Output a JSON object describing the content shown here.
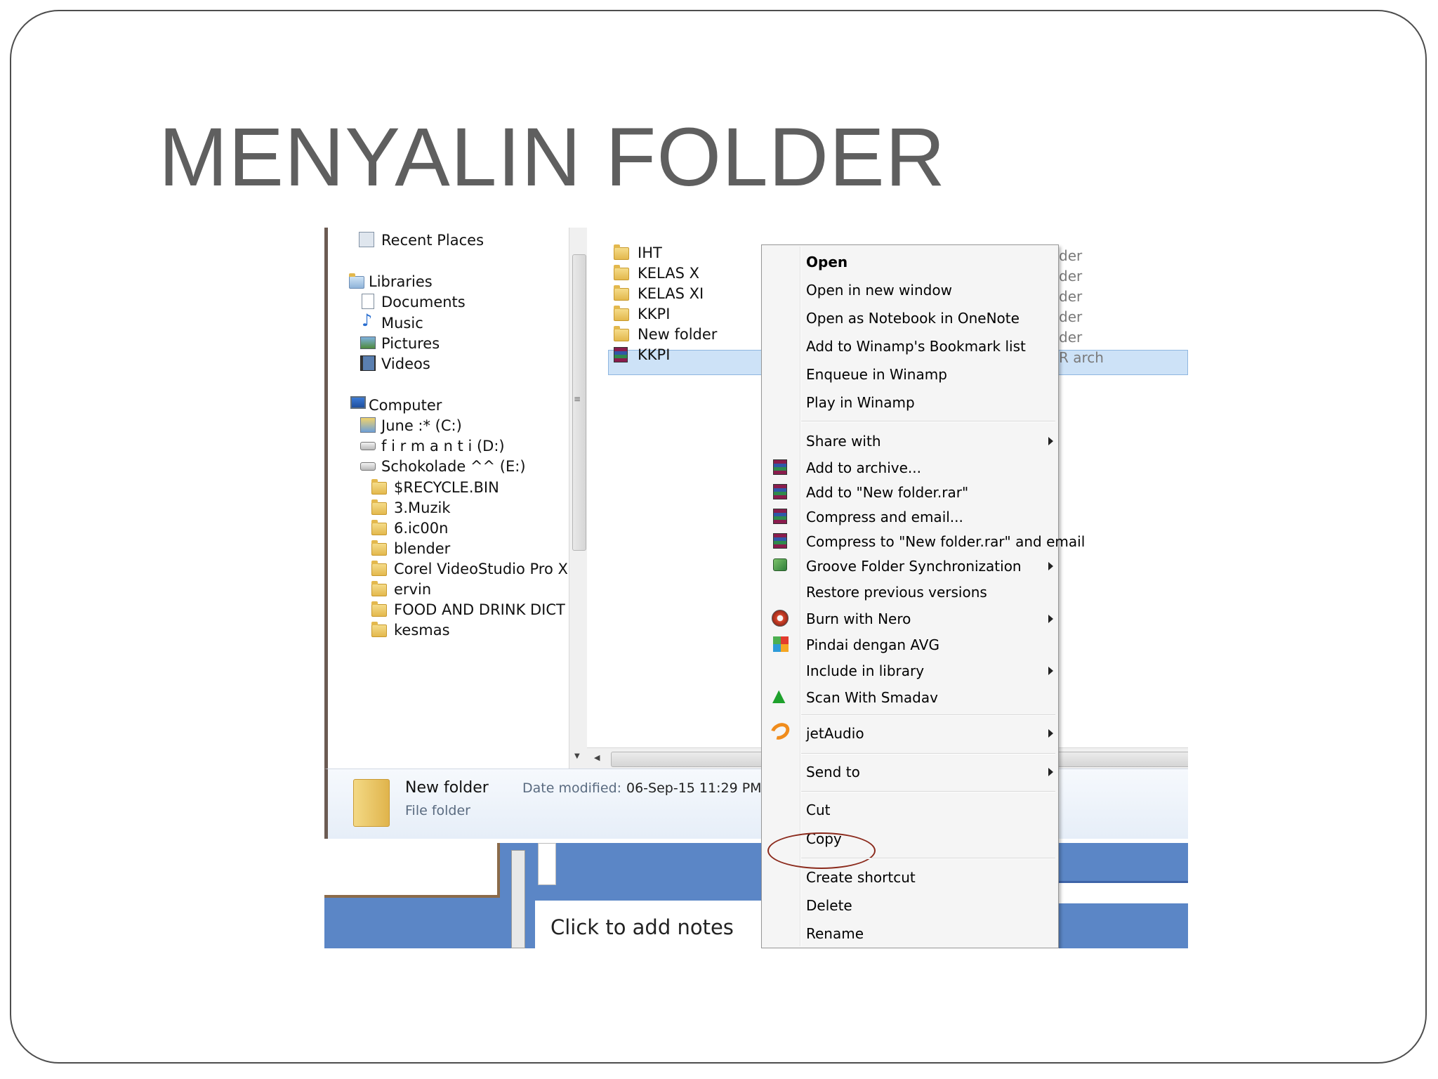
{
  "slide": {
    "title": "MENYALIN FOLDER"
  },
  "nav": {
    "items": [
      {
        "label": "Recent Places",
        "icon": "recent-places-icon"
      },
      {
        "label": "Libraries",
        "icon": "libraries-icon"
      },
      {
        "label": "Documents",
        "icon": "documents-icon"
      },
      {
        "label": "Music",
        "icon": "music-icon"
      },
      {
        "label": "Pictures",
        "icon": "pictures-icon"
      },
      {
        "label": "Videos",
        "icon": "videos-icon"
      },
      {
        "label": "Computer",
        "icon": "computer-icon"
      },
      {
        "label": "June :* (C:)",
        "icon": "drive-icon"
      },
      {
        "label": "f i r m a n t i (D:)",
        "icon": "drive-icon"
      },
      {
        "label": "Schokolade ^^ (E:)",
        "icon": "drive-icon"
      },
      {
        "label": "$RECYCLE.BIN",
        "icon": "folder-icon"
      },
      {
        "label": "3.Muzik",
        "icon": "folder-icon"
      },
      {
        "label": "6.ic00n",
        "icon": "folder-icon"
      },
      {
        "label": "blender",
        "icon": "folder-icon"
      },
      {
        "label": "Corel VideoStudio Pro X",
        "icon": "folder-icon"
      },
      {
        "label": "ervin",
        "icon": "folder-icon"
      },
      {
        "label": "FOOD AND DRINK DICT",
        "icon": "folder-icon"
      },
      {
        "label": "kesmas",
        "icon": "folder-icon"
      }
    ]
  },
  "files": [
    {
      "name": "IHT",
      "type": "folder",
      "ghost": "der"
    },
    {
      "name": "KELAS X",
      "type": "folder",
      "ghost": "der"
    },
    {
      "name": "KELAS XI",
      "type": "folder",
      "ghost": "der"
    },
    {
      "name": "KKPI",
      "type": "folder",
      "ghost": "der"
    },
    {
      "name": "New folder",
      "type": "folder",
      "ghost": "der",
      "selected": true
    },
    {
      "name": "KKPI",
      "type": "rar",
      "ghost": "R arch"
    }
  ],
  "details": {
    "name": "New folder",
    "date_label": "Date modified:",
    "date_value": "06-Sep-15 11:29 PM",
    "type": "File folder"
  },
  "notes": {
    "placeholder": "Click to add notes"
  },
  "context_menu": {
    "items": [
      {
        "label": "Open",
        "bold": true
      },
      {
        "label": "Open in new window"
      },
      {
        "label": "Open as Notebook in OneNote"
      },
      {
        "label": "Add to Winamp's Bookmark list"
      },
      {
        "label": "Enqueue in Winamp"
      },
      {
        "label": "Play in Winamp"
      },
      {
        "label": "Share with",
        "submenu": true
      },
      {
        "label": "Add to archive...",
        "icon": "winrar-icon"
      },
      {
        "label": "Add to \"New folder.rar\"",
        "icon": "winrar-icon"
      },
      {
        "label": "Compress and email...",
        "icon": "winrar-icon"
      },
      {
        "label": "Compress to \"New folder.rar\" and email",
        "icon": "winrar-icon"
      },
      {
        "label": "Groove Folder Synchronization",
        "icon": "groove-icon",
        "submenu": true
      },
      {
        "label": "Restore previous versions"
      },
      {
        "label": "Burn with Nero",
        "icon": "nero-icon",
        "submenu": true
      },
      {
        "label": "Pindai dengan AVG",
        "icon": "avg-icon"
      },
      {
        "label": "Include in library",
        "submenu": true
      },
      {
        "label": "Scan With Smadav",
        "icon": "smadav-icon"
      },
      {
        "label": "jetAudio",
        "icon": "jetaudio-icon",
        "submenu": true
      },
      {
        "label": "Send to",
        "submenu": true
      },
      {
        "label": "Cut"
      },
      {
        "label": "Copy",
        "highlighted": true
      },
      {
        "label": "Create shortcut"
      },
      {
        "label": "Delete"
      },
      {
        "label": "Rename"
      }
    ]
  },
  "colors": {
    "title": "#5f5f5f",
    "selection": "#cde2f7",
    "taskbar": "#5b86c6",
    "highlight_circle": "#8b2a1c"
  }
}
